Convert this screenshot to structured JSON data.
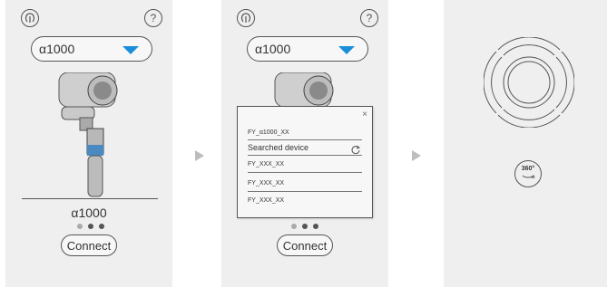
{
  "panel1": {
    "model_select": {
      "value": "α1000"
    },
    "model_name": "α1000",
    "connect_label": "Connect"
  },
  "panel2": {
    "model_select": {
      "value": "α1000"
    },
    "popup": {
      "close": "×",
      "connected_device": "FY_α1000_XX",
      "searched_label": "Searched device",
      "devices": [
        "FY_XXX_XX",
        "FY_XXX_XX",
        "FY_XXX_XX"
      ]
    },
    "connect_label": "Connect"
  },
  "panel3": {
    "rotate_label": "360°"
  },
  "icons": {
    "help": "?",
    "close": "×"
  },
  "colors": {
    "accent": "#1a8ed8",
    "panel_bg": "#efefef"
  }
}
